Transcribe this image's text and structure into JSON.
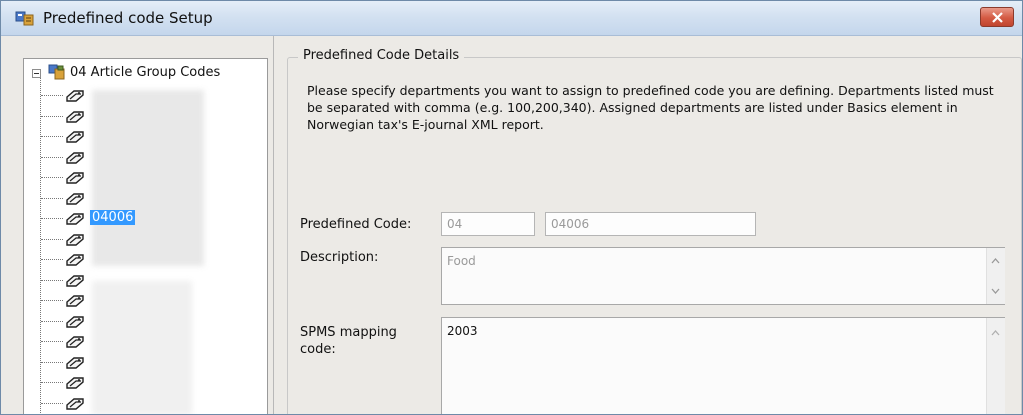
{
  "window": {
    "title": "Predefined code Setup",
    "accent_color": "#c0452f",
    "title_bar_color": "#d3e1f1"
  },
  "tree": {
    "root": {
      "label": "04 Article Group Codes",
      "icon": "code-group-icon",
      "expanded": true
    },
    "items": [
      {
        "label": ""
      },
      {
        "label": ""
      },
      {
        "label": ""
      },
      {
        "label": ""
      },
      {
        "label": ""
      },
      {
        "label": ""
      },
      {
        "label": "04006",
        "selected": true
      },
      {
        "label": ""
      },
      {
        "label": ""
      },
      {
        "label": ""
      },
      {
        "label": ""
      },
      {
        "label": ""
      },
      {
        "label": ""
      },
      {
        "label": ""
      },
      {
        "label": ""
      },
      {
        "label": ""
      }
    ],
    "item_icon": "code-node-icon",
    "selection_color": "#3399ff"
  },
  "details": {
    "group_label": "Predefined Code Details",
    "info_text": "Please specify departments you want to assign to predefined code you are defining. Departments listed must be separated with comma (e.g. 100,200,340). Assigned departments are listed under Basics element in Norwegian tax's E-journal XML report.",
    "predefined_code_label": "Predefined Code:",
    "predefined_code_prefix": "04",
    "predefined_code_value": "04006",
    "description_label": "Description:",
    "description_value": "Food",
    "spms_label": "SPMS mapping code:",
    "spms_value": "2003"
  }
}
